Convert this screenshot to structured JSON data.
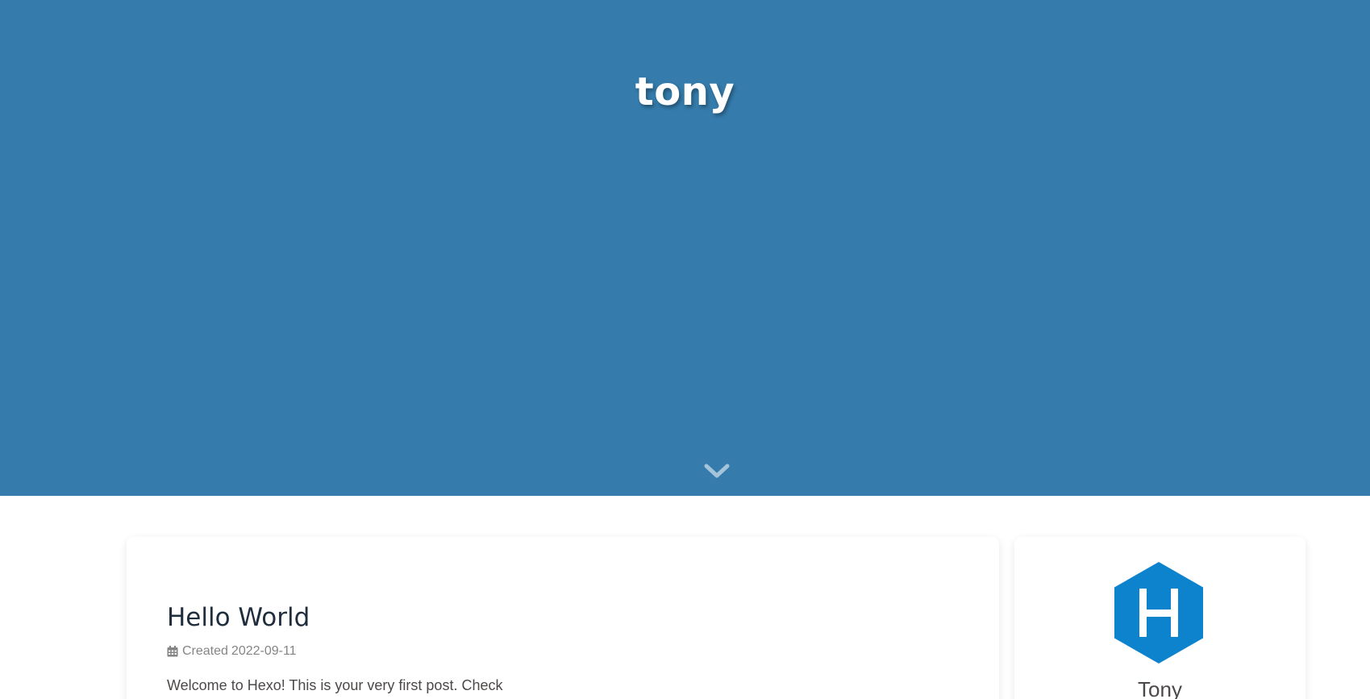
{
  "site": {
    "title": "tony"
  },
  "hero": {
    "background_color": "#357cac",
    "scroll_icon": "chevron-down-icon"
  },
  "post": {
    "title": "Hello World",
    "meta_icon": "calendar-icon",
    "created_label": "Created",
    "created_date": "2022-09-11",
    "excerpt": "Welcome to Hexo! This is your very first post. Check"
  },
  "author": {
    "avatar_icon": "hexo-logo-icon",
    "avatar_color": "#0e83cd",
    "name": "Tony"
  }
}
